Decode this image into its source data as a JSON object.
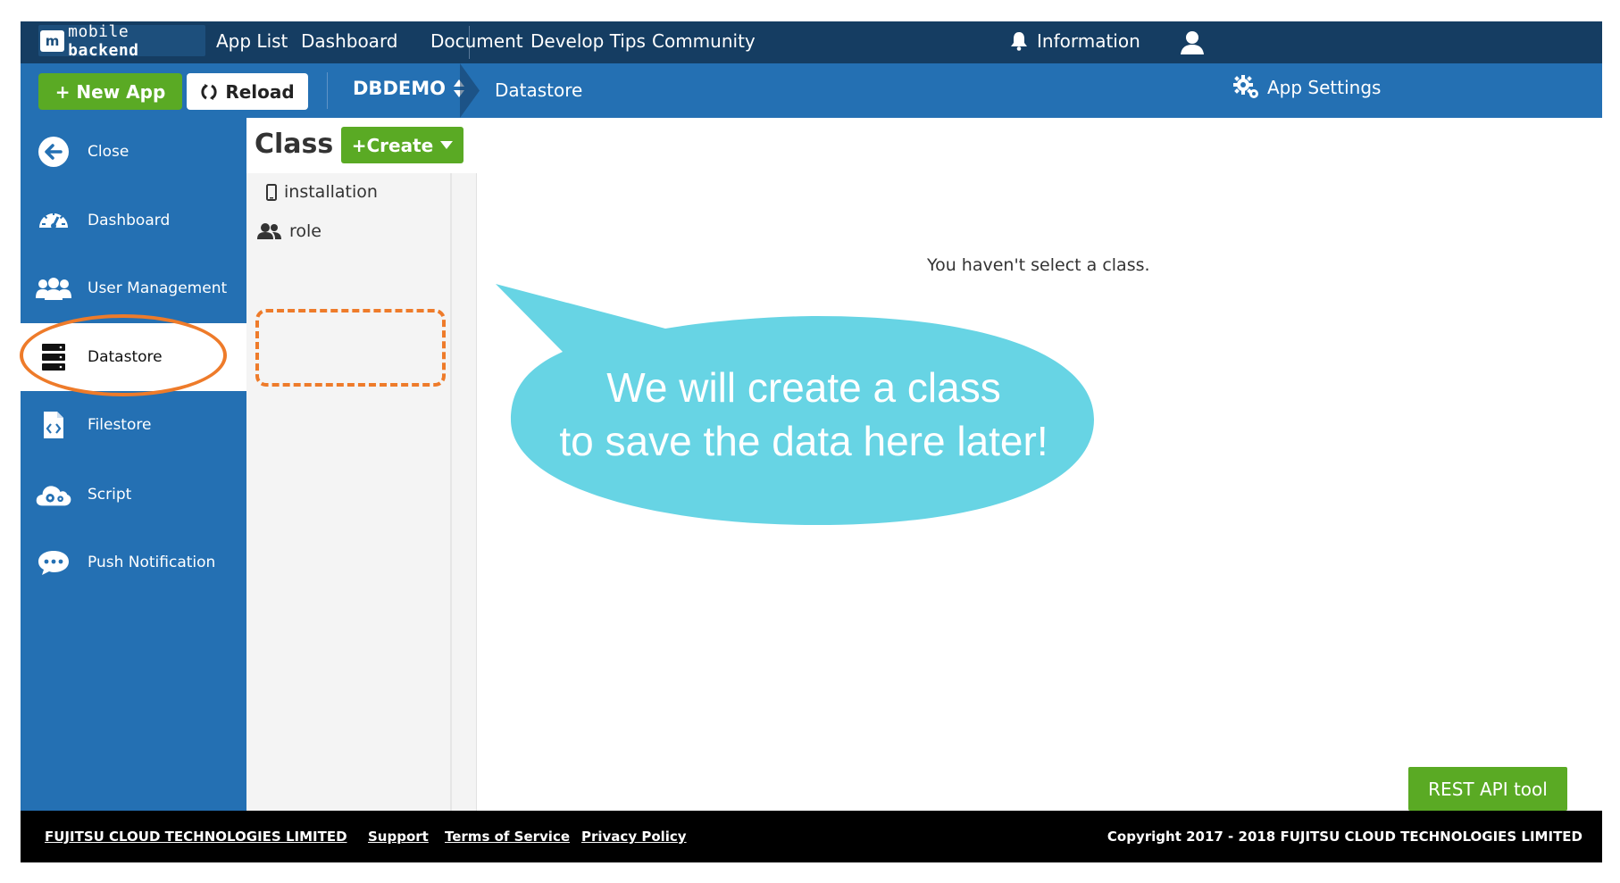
{
  "header": {
    "logo_text_light": "mobile",
    "logo_text_bold": " backend",
    "logo_mark": "m",
    "nav": [
      "App List",
      "Dashboard",
      "Document",
      "Develop Tips",
      "Community"
    ],
    "information": "Information",
    "icons": {
      "bell": "bell-icon",
      "user": "user-icon"
    }
  },
  "toolbar": {
    "new_app": "+ New App",
    "reload": "Reload",
    "app_name": "DBDEMO",
    "breadcrumb": "Datastore",
    "app_settings": "App Settings"
  },
  "sidebar": {
    "items": [
      {
        "label": "Close",
        "icon": "arrow-left-icon"
      },
      {
        "label": "Dashboard",
        "icon": "gauge-icon"
      },
      {
        "label": "User Management",
        "icon": "users-icon"
      },
      {
        "label": "Datastore",
        "icon": "database-icon",
        "active": true
      },
      {
        "label": "Filestore",
        "icon": "file-code-icon"
      },
      {
        "label": "Script",
        "icon": "cloud-gear-icon"
      },
      {
        "label": "Push Notification",
        "icon": "chat-bubble-icon"
      }
    ]
  },
  "classes": {
    "title": "Class",
    "create": "+Create",
    "items": [
      {
        "label": "installation",
        "icon": "phone-icon"
      },
      {
        "label": "role",
        "icon": "users-icon"
      }
    ]
  },
  "main": {
    "empty_message": "You haven't select a class.",
    "rest_api": "REST API tool"
  },
  "callout": {
    "line1": "We will create a class",
    "line2": "to save the data here later!"
  },
  "footer": {
    "company": "FUJITSU CLOUD TECHNOLOGIES LIMITED",
    "support": "Support",
    "terms": "Terms of Service",
    "privacy": "Privacy Policy",
    "copyright": "Copyright 2017 - 2018 FUJITSU CLOUD TECHNOLOGIES LIMITED"
  },
  "colors": {
    "top_nav": "#153d62",
    "primary_blue": "#2470b3",
    "green": "#5aaa24",
    "annotation_orange": "#ee7b2a",
    "callout_cyan": "#67d4e4"
  }
}
